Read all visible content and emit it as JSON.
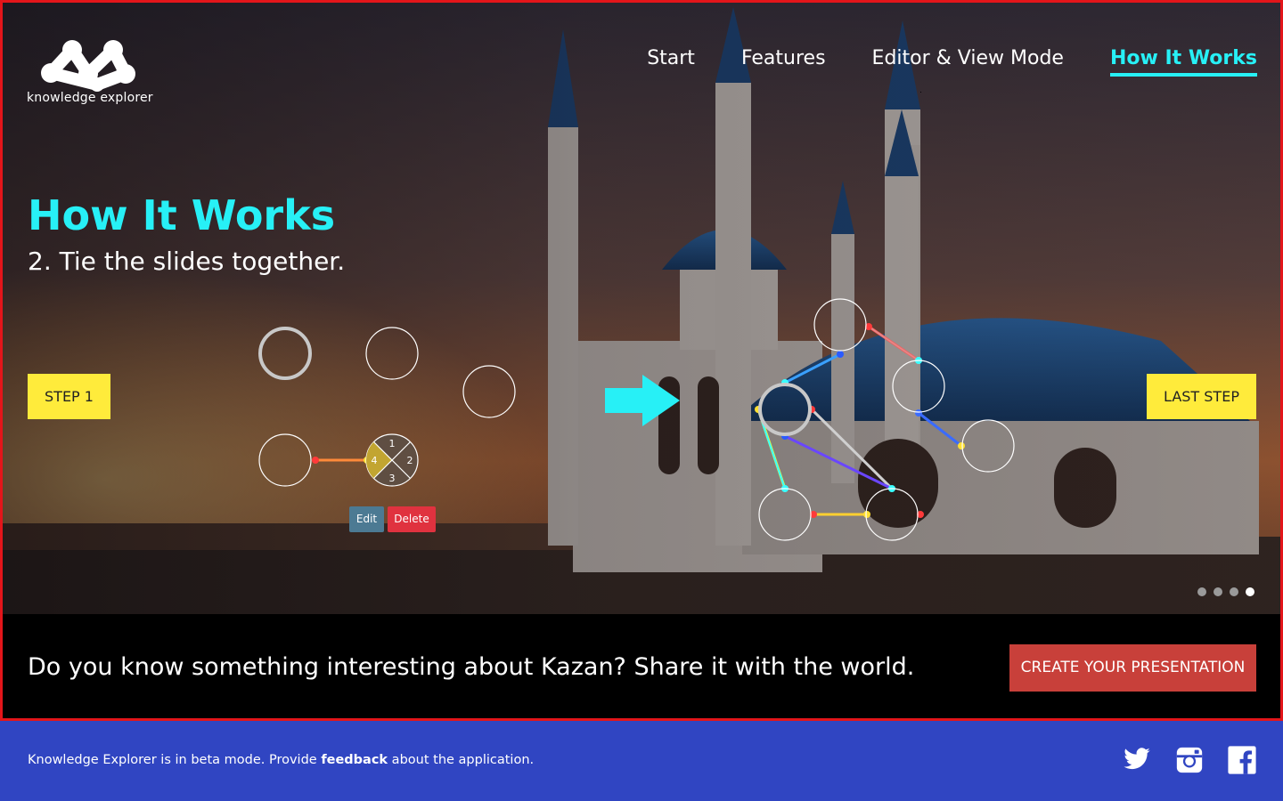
{
  "brand": {
    "name": "knowledge explorer"
  },
  "nav": {
    "items": [
      {
        "label": "Start"
      },
      {
        "label": "Features"
      },
      {
        "label": "Editor & View Mode"
      },
      {
        "label": "How It Works",
        "active": true
      }
    ]
  },
  "hero": {
    "title": "How It Works",
    "subtitle": "2. Tie the slides together.",
    "prev_button": "STEP 1",
    "next_button": "LAST STEP",
    "node_menu": {
      "edit": "Edit",
      "delete": "Delete",
      "segments": [
        "1",
        "2",
        "3",
        "4"
      ]
    },
    "carousel": {
      "total": 4,
      "active": 4
    }
  },
  "cta": {
    "text": "Do you know something interesting about Kazan? Share it with the world.",
    "button": "CREATE YOUR PRESENTATION"
  },
  "footer": {
    "text_before": "Knowledge Explorer is in beta mode. Provide ",
    "link": "feedback",
    "text_after": " about the application.",
    "social": [
      "twitter-icon",
      "instagram-icon",
      "facebook-icon"
    ]
  },
  "colors": {
    "accent": "#27f0f6",
    "yellow": "#ffeb3b",
    "cta_red": "#c8403a",
    "footer_blue": "#3045c2",
    "frame_red": "#e3151a"
  }
}
